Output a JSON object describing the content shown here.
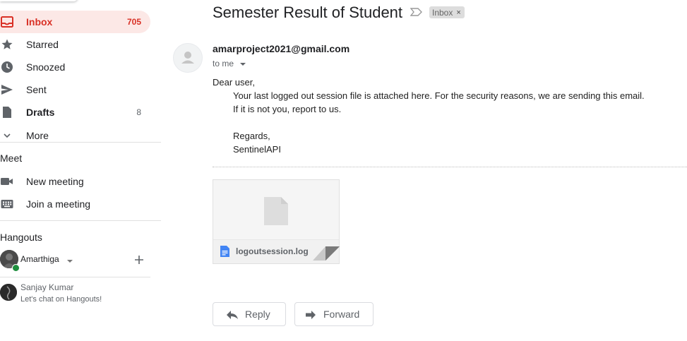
{
  "nav": {
    "inbox": {
      "label": "Inbox",
      "count": "705"
    },
    "starred": {
      "label": "Starred"
    },
    "snoozed": {
      "label": "Snoozed"
    },
    "sent": {
      "label": "Sent"
    },
    "drafts": {
      "label": "Drafts",
      "count": "8"
    },
    "more": {
      "label": "More"
    }
  },
  "meet": {
    "title": "Meet",
    "new_meeting": "New meeting",
    "join_meeting": "Join a meeting"
  },
  "hangouts": {
    "title": "Hangouts",
    "current_user": "Amarthiga",
    "contact_name": "Sanjay Kumar",
    "contact_status": "Let's chat on Hangouts!"
  },
  "email": {
    "subject": "Semester Result of Student",
    "label": "Inbox",
    "label_close": "×",
    "sender": "amarproject2021@gmail.com",
    "recipient": "to me",
    "greeting": "Dear user,",
    "body_line1": "Your last logged out session file is attached here. For the security reasons, we are sending this email.",
    "body_line2": "If it is not you, report to us.",
    "sign_off": "Regards,",
    "signature": "SentinelAPI"
  },
  "attachment": {
    "filename": "logoutsession.log"
  },
  "actions": {
    "reply": "Reply",
    "forward": "Forward"
  },
  "colors": {
    "accent": "#d93025",
    "active_bg": "#fce8e6",
    "file_blue": "#4285f4"
  }
}
